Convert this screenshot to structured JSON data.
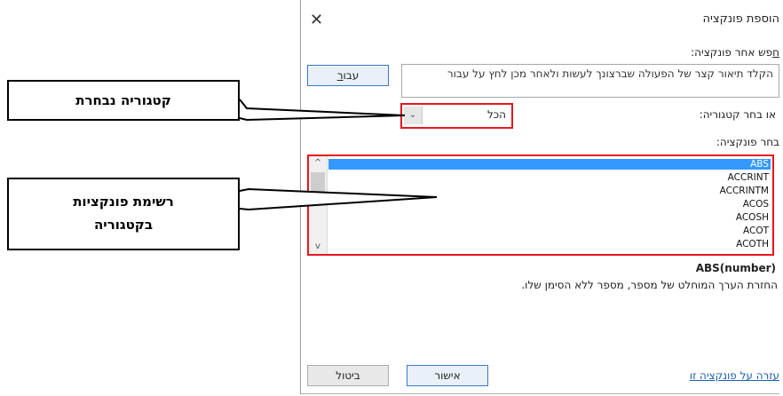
{
  "dialog": {
    "title": "הוספת פונקציה",
    "close_symbol": "✕",
    "search_label_prefix": "",
    "search_label_underlined": "ח",
    "search_label_rest": "פש אחר פונקציה:",
    "search_text": "הקלד תיאור קצר של הפעולה שברצונך לעשות ולאחר מכן לחץ על עבור",
    "go_button_label": "עבו",
    "go_button_underlined": "ר",
    "category_label": "או בחר קטגוריה:",
    "category_value": "הכל",
    "function_label": "בחר פונקציה:",
    "functions": [
      "ABS",
      "ACCRINT",
      "ACCRINTM",
      "ACOS",
      "ACOSH",
      "ACOT",
      "ACOTH"
    ],
    "selected_function": "ABS",
    "signature": "ABS(number)",
    "description": "החזרת הערך המוחלט של מספר, מספר ללא הסימן שלו.",
    "help_link": "עזרה על פונקציה זו",
    "ok_label": "אישור",
    "cancel_label": "ביטול"
  },
  "callouts": {
    "category": "קטגוריה נבחרת",
    "list_line1": "רשימת פונקציות",
    "list_line2": "בקטגוריה"
  },
  "colors": {
    "highlight_border": "#e8151e",
    "selection": "#3399ff",
    "link": "#1a5fb4"
  }
}
